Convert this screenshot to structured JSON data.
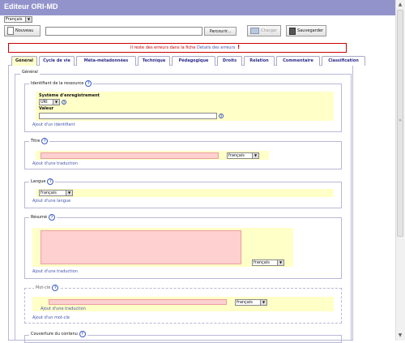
{
  "app": {
    "title": "Editeur ORI-MD"
  },
  "language": {
    "selected": "Français"
  },
  "toolbar": {
    "new_label": "Nouveau",
    "browse_label": "Parcourir...",
    "load_label": "Charger",
    "save_label": "Sauvegarder"
  },
  "errors": {
    "message": "Il reste des erreurs dans la fiche",
    "details_label": "Détails des erreurs",
    "marker": "!"
  },
  "tabs": [
    {
      "label": "Général"
    },
    {
      "label": "Cycle de vie"
    },
    {
      "label": "Méta-métadonnées"
    },
    {
      "label": "Technique"
    },
    {
      "label": "Pédagogique"
    },
    {
      "label": "Droits"
    },
    {
      "label": "Relation"
    },
    {
      "label": "Commentaire"
    },
    {
      "label": "Classification"
    }
  ],
  "general": {
    "legend": "Général",
    "identifier": {
      "legend": "Identifiant de la ressource",
      "system_label": "Système d'enregistrement",
      "system_value": "URI",
      "value_label": "Valeur",
      "add_link": "Ajout d'un identifiant"
    },
    "title": {
      "legend": "Titre",
      "lang": "français",
      "add_link": "Ajout d'une traduction"
    },
    "language": {
      "legend": "Langue",
      "value": "français",
      "add_link": "Ajout d'une langue"
    },
    "summary": {
      "legend": "Résumé",
      "lang": "français",
      "add_link": "Ajout d'une traduction"
    },
    "keyword": {
      "legend": "Mot-clé",
      "lang": "français",
      "add_translation": "Ajout d'une traduction",
      "add_keyword": "Ajout d'un mot-clé"
    },
    "coverage": {
      "legend": "Couverture du contenu"
    }
  },
  "scrollbar": {
    "up": "▲",
    "down": "▼",
    "mid": "»"
  },
  "colors": {
    "titlebar": "#9393cc",
    "required_field": "#ffd0d0",
    "section_fill": "#ffffc8",
    "error_border": "#cc0000"
  }
}
